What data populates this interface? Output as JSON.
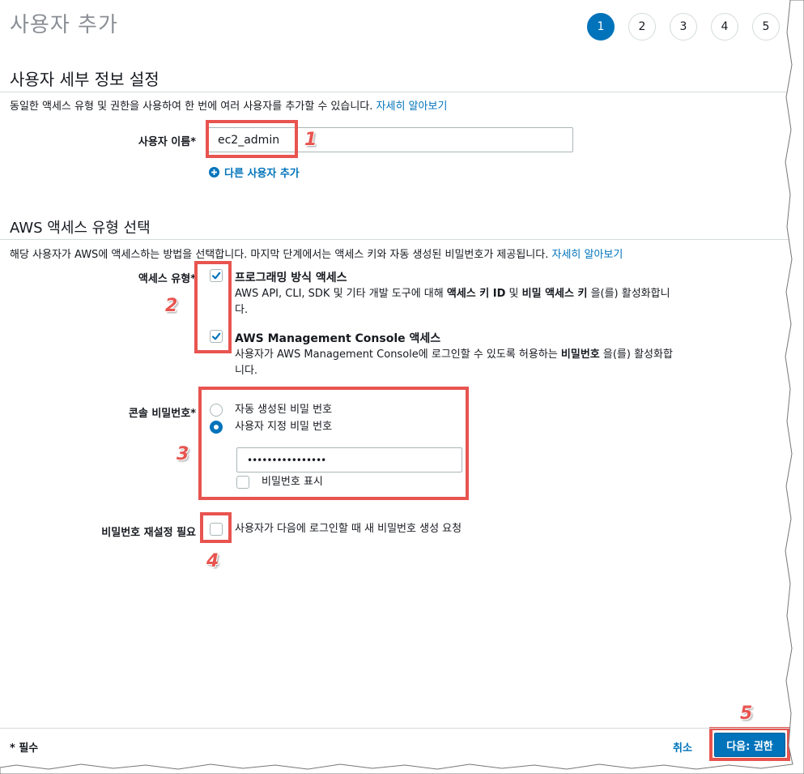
{
  "header": {
    "title": "사용자 추가",
    "steps": [
      "1",
      "2",
      "3",
      "4",
      "5"
    ]
  },
  "details": {
    "section_title": "사용자 세부 정보 설정",
    "description": "동일한 액세스 유형 및 권한을 사용하여 한 번에 여러 사용자를 추가할 수 있습니다.",
    "learn_more": "자세히 알아보기",
    "username_label": "사용자 이름*",
    "username_value": "ec2_admin",
    "add_user_link": "다른 사용자 추가"
  },
  "access": {
    "section_title": "AWS 액세스 유형 선택",
    "description": "해당 사용자가 AWS에 액세스하는 방법을 선택합니다. 마지막 단계에서는 액세스 키와 자동 생성된 비밀번호가 제공됩니다.",
    "learn_more": "자세히 알아보기",
    "type_label": "액세스 유형*",
    "programmatic": {
      "title": "프로그래밍 방식 액세스",
      "line1_pre": "AWS API, CLI, SDK 및 기타 개발 도구에 대해 ",
      "line1_bold1": "액세스 키 ID",
      "line1_mid": " 및 ",
      "line1_bold2": "비밀 액세스 키",
      "line1_post": " 을(를) 활성화합니",
      "line2": "다.",
      "checked": true
    },
    "console": {
      "title": "AWS Management Console 액세스",
      "line1_pre": "사용자가 AWS Management Console에 로그인할 수 있도록 허용하는 ",
      "line1_bold": "비밀번호",
      "line1_post": " 을(를) 활성화합",
      "line2": "니다.",
      "checked": true
    },
    "password_label": "콘솔 비밀번호*",
    "auto_option": "자동 생성된 비밀 번호",
    "custom_option": "사용자 지정 비밀 번호",
    "password_value": "••••••••••••••••",
    "show_password": "비밀번호 표시",
    "reset_label": "비밀번호 재설정 필요",
    "reset_text": "사용자가 다음에 로그인할 때 새 비밀번호 생성 요청"
  },
  "annotations": [
    "1",
    "2",
    "3",
    "4",
    "5"
  ],
  "footer": {
    "required_note": "* 필수",
    "cancel": "취소",
    "next": "다음: 권한"
  },
  "colors": {
    "primary": "#0073bb",
    "annotation_red": "#e8544f",
    "title_gray": "#8a8f95"
  }
}
